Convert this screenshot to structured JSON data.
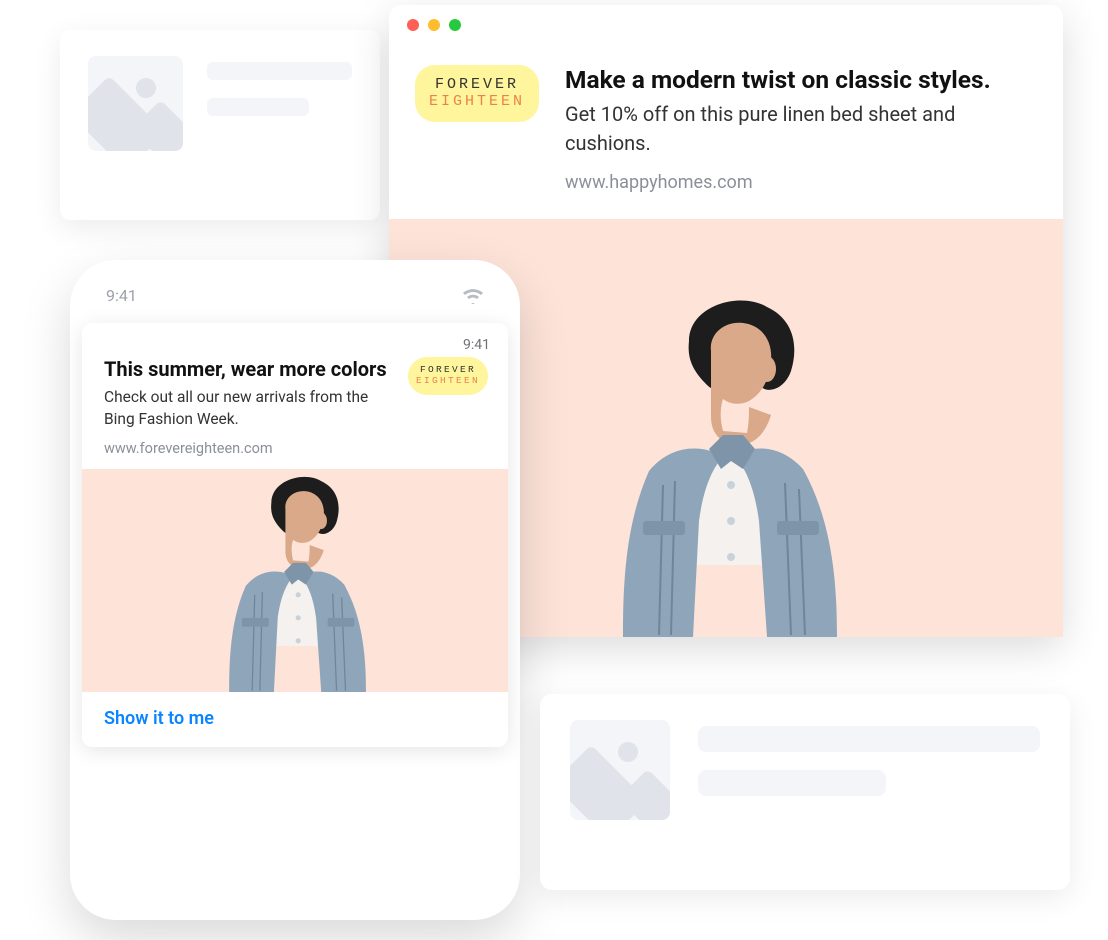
{
  "brand": {
    "line1": "FOREVER",
    "line2": "EIGHTEEN"
  },
  "browser": {
    "headline": "Make a modern twist on classic styles.",
    "subhead": "Get 10% off on this pure linen bed sheet and cushions.",
    "link": "www.happyhomes.com"
  },
  "phone": {
    "status_time": "9:41",
    "card_time": "9:41",
    "headline": "This summer, wear more colors",
    "subhead": "Check out all our new arrivals from the Bing Fashion Week.",
    "link": "www.forevereighteen.com",
    "cta": "Show it to me"
  }
}
